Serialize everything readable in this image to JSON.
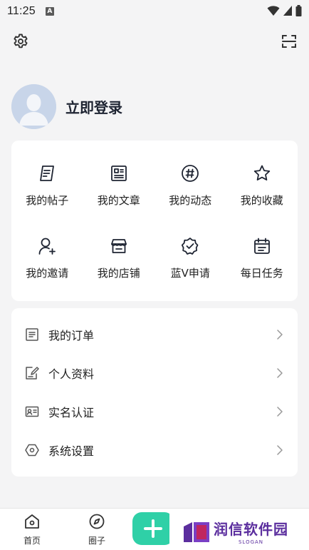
{
  "status_bar": {
    "time": "11:25",
    "badge": "A"
  },
  "profile": {
    "login_label": "立即登录"
  },
  "grid": [
    {
      "label": "我的帖子",
      "icon": "post-icon"
    },
    {
      "label": "我的文章",
      "icon": "article-icon"
    },
    {
      "label": "我的动态",
      "icon": "hashtag-icon"
    },
    {
      "label": "我的收藏",
      "icon": "star-icon"
    },
    {
      "label": "我的邀请",
      "icon": "invite-user-icon"
    },
    {
      "label": "我的店铺",
      "icon": "store-icon"
    },
    {
      "label": "蓝V申请",
      "icon": "verified-badge-icon"
    },
    {
      "label": "每日任务",
      "icon": "calendar-task-icon"
    }
  ],
  "menu": [
    {
      "label": "我的订单",
      "icon": "order-icon"
    },
    {
      "label": "个人资料",
      "icon": "edit-profile-icon"
    },
    {
      "label": "实名认证",
      "icon": "id-card-icon"
    },
    {
      "label": "系统设置",
      "icon": "settings-hexagon-icon"
    }
  ],
  "bottom_nav": {
    "home_label": "首页",
    "circle_label": "圈子"
  },
  "watermark": {
    "main": "润信软件园",
    "sub": "SLOGAN"
  },
  "colors": {
    "accent": "#2fd0a7",
    "watermark": "#5b2e9e",
    "background": "#f4f4f5"
  }
}
